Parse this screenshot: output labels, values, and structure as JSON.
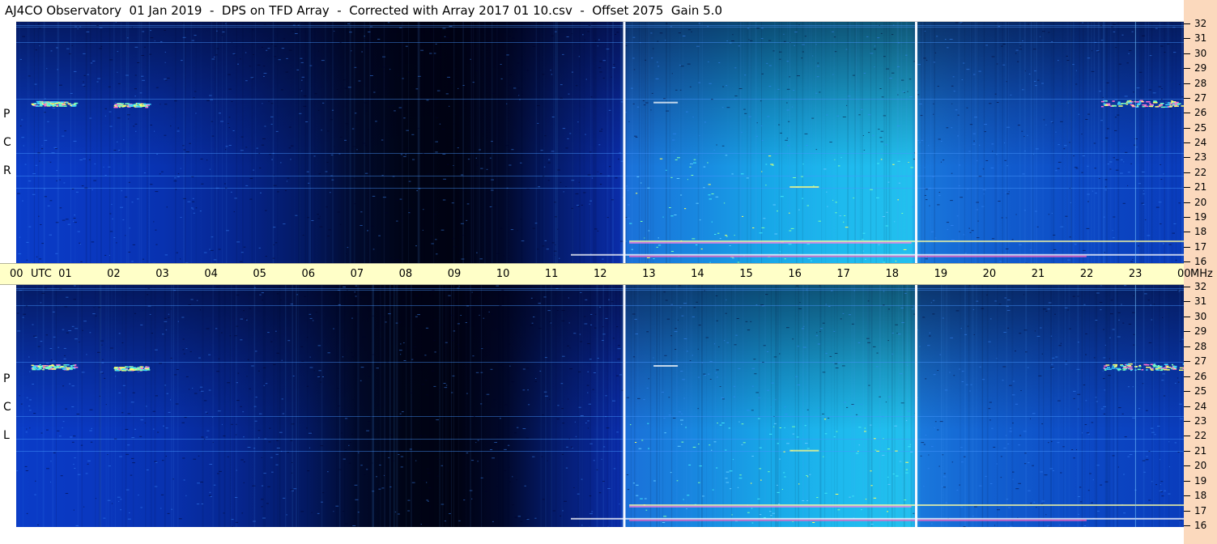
{
  "header": {
    "title": "AJ4CO Observatory  01 Jan 2019  -  DPS on TFD Array  -  Corrected with Array 2017 01 10.csv  -  Offset 2075  Gain 5.0"
  },
  "panels": [
    {
      "polarization_letters": [
        "R",
        "C",
        "P"
      ]
    },
    {
      "polarization_letters": [
        "L",
        "C",
        "P"
      ]
    }
  ],
  "utc_axis": {
    "unit_label": "UTC",
    "freq_unit": "MHz",
    "hour_labels": [
      "00",
      "01",
      "02",
      "03",
      "04",
      "05",
      "06",
      "07",
      "08",
      "09",
      "10",
      "11",
      "12",
      "13",
      "14",
      "15",
      "16",
      "17",
      "18",
      "19",
      "20",
      "21",
      "22",
      "23",
      "00"
    ]
  },
  "freq_axis": {
    "labels": [
      "32",
      "31",
      "30",
      "29",
      "28",
      "27",
      "26",
      "25",
      "24",
      "23",
      "22",
      "21",
      "20",
      "19",
      "18",
      "17",
      "16"
    ]
  },
  "colors": {
    "background_deep": "#000010",
    "background_blue": "#0a30c8",
    "daytime_cyan": "#18a8e8",
    "utc_bar": "#ffffc8",
    "freq_strip": "#fbd9bd"
  },
  "chart_data": {
    "type": "heatmap",
    "x_axis": {
      "label": "UTC",
      "range": [
        0,
        24
      ]
    },
    "y_axis": {
      "label": "MHz",
      "range": [
        16,
        32
      ]
    },
    "panels": [
      "RCP",
      "LCP"
    ],
    "calibration_lines_utc": [
      12.5,
      18.5
    ],
    "notes_visible": "dynamic spectrum; darkest near 07-10 UTC, brightest 13-18 UTC"
  }
}
